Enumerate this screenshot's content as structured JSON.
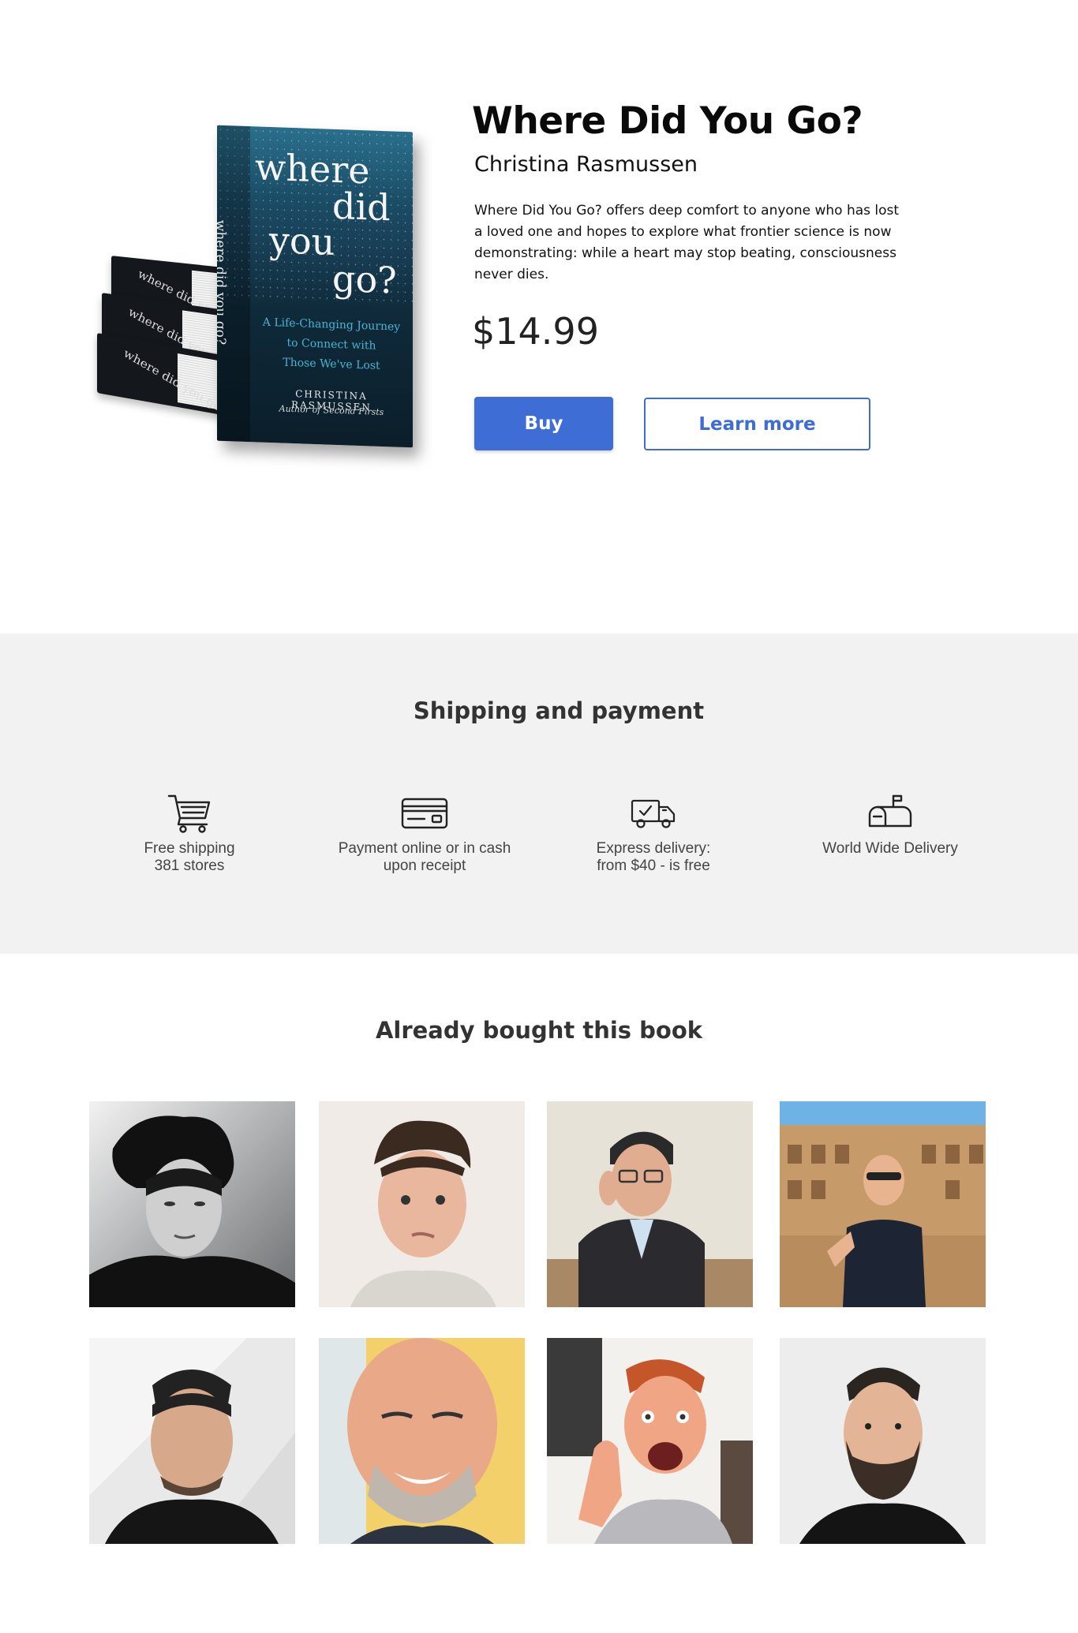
{
  "product": {
    "title": "Where Did You Go?",
    "author": "Christina Rasmussen",
    "description": "Where Did You Go? offers deep comfort to anyone who has lost a loved one and hopes to explore what frontier science is now demonstrating: while a heart may stop beating, consciousness never dies.",
    "price": "$14.99",
    "buy_label": "Buy",
    "learn_more_label": "Learn more",
    "cover": {
      "title_lines": [
        "where",
        "did",
        "you",
        "go?"
      ],
      "subtitle_lines": [
        "A Life-Changing Journey",
        "to Connect with",
        "Those We've Lost"
      ],
      "author": "CHRISTINA RASMUSSEN",
      "author_note": "Author of Second Firsts",
      "spine_title": "where did you go?"
    }
  },
  "shipping": {
    "title": "Shipping and payment",
    "items": [
      {
        "icon": "shopping-cart-icon",
        "line1": "Free shipping",
        "line2": "381 stores"
      },
      {
        "icon": "credit-card-icon",
        "line1": "Payment online or in cash",
        "line2": "upon receipt"
      },
      {
        "icon": "delivery-truck-icon",
        "line1": "Express delivery:",
        "line2": "from $40 - is free"
      },
      {
        "icon": "mailbox-icon",
        "line1": "World Wide Delivery",
        "line2": ""
      }
    ]
  },
  "buyers": {
    "title": "Already bought this book"
  },
  "colors": {
    "accent": "#3e6dd6",
    "section_bg": "#f2f2f2",
    "heading": "#333333"
  }
}
